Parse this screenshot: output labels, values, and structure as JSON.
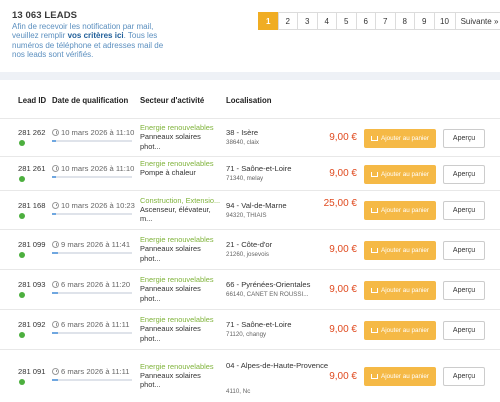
{
  "header": {
    "leads_count": "13 063 LEADS",
    "info_text_1": "Afin de recevoir les notification par mail, veuillez remplir ",
    "info_link": "vos critères ici",
    "info_text_2": ". Tous les numéros de téléphone et adresses mail de nos leads sont vérifiés."
  },
  "pagination": {
    "pages": [
      "1",
      "2",
      "3",
      "4",
      "5",
      "6",
      "7",
      "8",
      "9",
      "10"
    ],
    "active": "1",
    "next_label": "Suivante »"
  },
  "table": {
    "columns": [
      "Lead ID",
      "Date de qualification",
      "Secteur d'activité",
      "Localisation"
    ],
    "cart_label": "Ajouter au panier",
    "view_label": "Aperçu",
    "rows": [
      {
        "id": "281 262",
        "date": "10 mars 2026 à 11:10",
        "progress": 0.05,
        "sector_main": "Energie renouvelables",
        "sector_sub": "Panneaux solaires phot...",
        "loc_main": "38 - Isère",
        "loc_sub": "38640, claix",
        "price": "9,00 €"
      },
      {
        "id": "281 261",
        "date": "10 mars 2026 à 11:10",
        "progress": 0.05,
        "sector_main": "Energie renouvelables",
        "sector_sub": "Pompe à chaleur",
        "loc_main": "71 - Saône-et-Loire",
        "loc_sub": "71340, melay",
        "price": "9,00 €"
      },
      {
        "id": "281 168",
        "date": "10 mars 2026 à 10:23",
        "progress": 0.05,
        "sector_main": "Construction, Extensio...",
        "sector_sub": "Ascenseur, élévateur, m...",
        "loc_main": "94 - Val-de-Marne",
        "loc_sub": "94320, THIAIS",
        "price": "25,00 €"
      },
      {
        "id": "281 099",
        "date": "9 mars 2026 à 11:41",
        "progress": 0.08,
        "sector_main": "Energie renouvelables",
        "sector_sub": "Panneaux solaires phot...",
        "loc_main": "21 - Côte-d'or",
        "loc_sub": "21260, josevois",
        "price": "9,00 €"
      },
      {
        "id": "281 093",
        "date": "6 mars 2026 à 11:20",
        "progress": 0.08,
        "sector_main": "Energie renouvelables",
        "sector_sub": "Panneaux solaires phot...",
        "loc_main": "66 - Pyrénées-Orientales",
        "loc_sub": "66140, CANET EN ROUSSI...",
        "price": "9,00 €"
      },
      {
        "id": "281 092",
        "date": "6 mars 2026 à 11:11",
        "progress": 0.08,
        "sector_main": "Energie renouvelables",
        "sector_sub": "Panneaux solaires phot...",
        "loc_main": "71 - Saône-et-Loire",
        "loc_sub": "71120, changy",
        "price": "9,00 €"
      },
      {
        "id": "281 091",
        "date": "6 mars 2026 à 11:11",
        "progress": 0.08,
        "sector_main": "Energie renouvelables",
        "sector_sub": "Panneaux solaires phot...",
        "loc_main": "04 - Alpes-de-Haute-Provence",
        "loc_sub": "4110, Nc",
        "price": "9,00 €"
      }
    ]
  },
  "colors": {
    "accent": "#f0ad23",
    "price": "#e04a1f",
    "sector": "#7fb33a",
    "status_dot": "#4caf3e",
    "link": "#1f5e99"
  }
}
